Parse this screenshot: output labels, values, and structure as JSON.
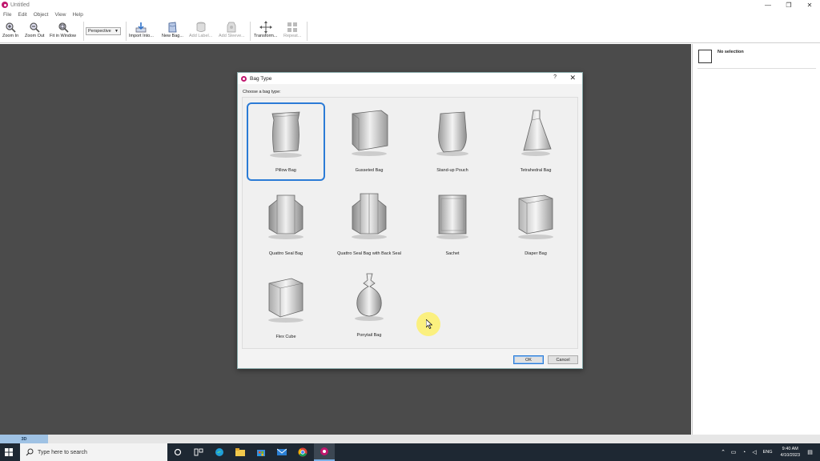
{
  "window": {
    "title": "Untitled",
    "controls": [
      "—",
      "❐",
      "✕"
    ]
  },
  "menu": [
    "File",
    "Edit",
    "Object",
    "View",
    "Help"
  ],
  "toolbar": {
    "zoom_in": "Zoom In",
    "zoom_out": "Zoom Out",
    "fit_window": "Fit in Window",
    "view_mode": "Perspective",
    "import_into": "Import Into...",
    "new_bag": "New Bag...",
    "add_label": "Add Label...",
    "add_sleeve": "Add Sleeve...",
    "transform": "Transform...",
    "repeat": "Repeat..."
  },
  "panel": {
    "selection": "No selection"
  },
  "bottom_tab": "3D",
  "dialog": {
    "title": "Bag Type",
    "help": "?",
    "close": "✕",
    "prompt": "Choose a bag type:",
    "bag_types": [
      {
        "label": "Pillow Bag",
        "selected": true
      },
      {
        "label": "Gusseted Bag",
        "selected": false
      },
      {
        "label": "Stand-up Pouch",
        "selected": false
      },
      {
        "label": "Tetrahedral Bag",
        "selected": false
      },
      {
        "label": "Quattro Seal Bag",
        "selected": false
      },
      {
        "label": "Quattro Seal Bag with Back Seal",
        "selected": false
      },
      {
        "label": "Sachet",
        "selected": false
      },
      {
        "label": "Diaper Bag",
        "selected": false
      },
      {
        "label": "Flex Cube",
        "selected": false
      },
      {
        "label": "Ponytail Bag",
        "selected": false
      }
    ],
    "ok": "OK",
    "cancel": "Cancel"
  },
  "taskbar": {
    "search_placeholder": "Type here to search",
    "language": "ENG",
    "time": "9:40 AM",
    "date": "4/10/2023"
  }
}
